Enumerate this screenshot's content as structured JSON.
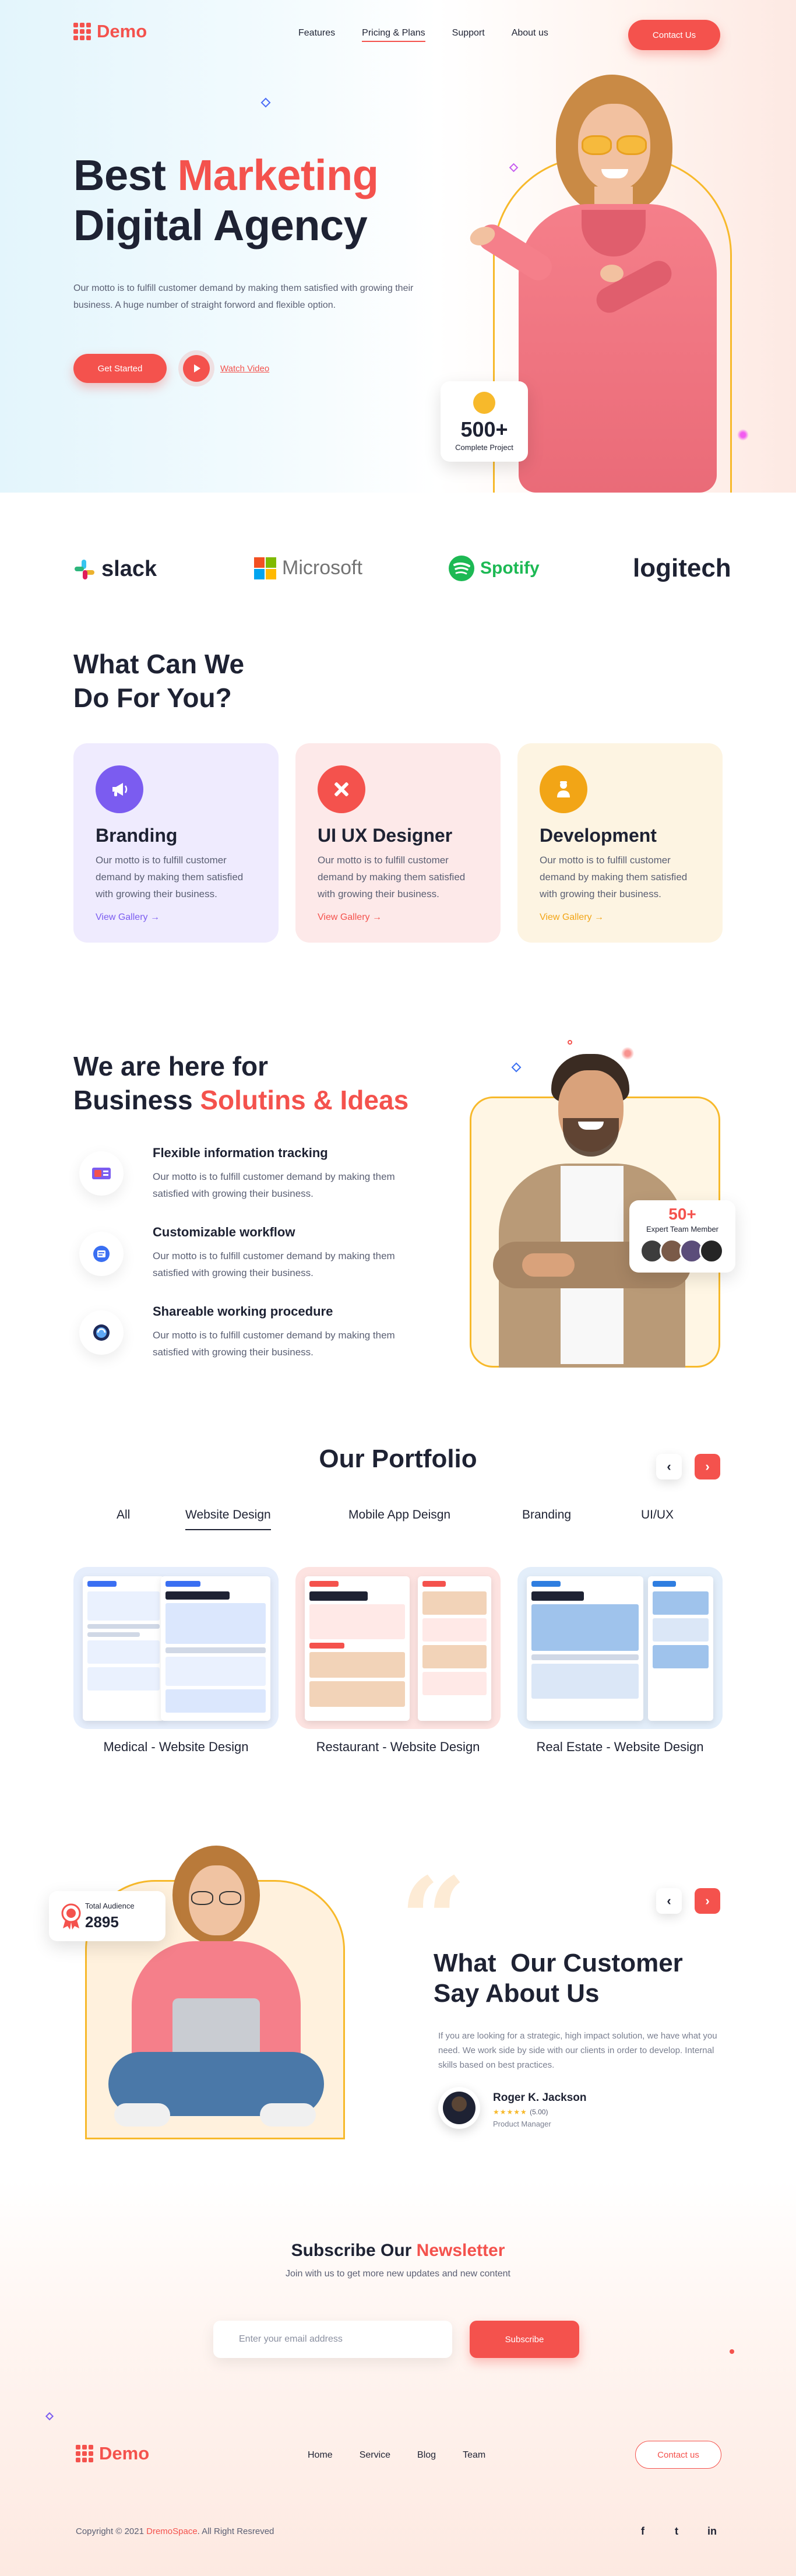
{
  "brand": {
    "name": "Demo",
    "accent": "#f4524d",
    "gold": "#f7b92b"
  },
  "nav": {
    "items": [
      "Features",
      "Pricing & Plans",
      "Support",
      "About us"
    ],
    "active": "Pricing & Plans",
    "contact_label": "Contact Us"
  },
  "hero": {
    "title_a": "Best ",
    "title_b": "Marketing",
    "title_c": "Digital Agency",
    "description": "Our motto is to fulfill customer demand by making them satisfied with growing their business. A huge number of straight forword and flexible option.",
    "cta_label": "Get Started",
    "video_label": "Watch Video",
    "stat_value": "500+",
    "stat_label": "Complete Project"
  },
  "brands": [
    "slack",
    "Microsoft",
    "Spotify",
    "logitech"
  ],
  "services": {
    "title_line1": "What Can We",
    "title_line2": "Do For You?",
    "link_label": "View Gallery →",
    "cards": [
      {
        "title": "Branding",
        "text": "Our motto is to fulfill customer demand by making them satisfied with growing their business.",
        "icon": "megaphone-icon",
        "bg": "#efebfe",
        "color": "#7b5cf0"
      },
      {
        "title": "UI UX Designer",
        "text": "Our motto is to fulfill customer demand by making them satisfied with growing their business.",
        "icon": "pencil-ruler-icon",
        "bg": "#fde9e9",
        "color": "#f4524d"
      },
      {
        "title": "Development",
        "text": "Our motto is to fulfill customer demand by making them satisfied with growing their business.",
        "icon": "developer-icon",
        "bg": "#fdf4e2",
        "color": "#f2a516"
      }
    ]
  },
  "features": {
    "title_line1": "We are here for",
    "title_line2a": "Business ",
    "title_line2b": "Solutins & Ideas",
    "items": [
      {
        "title": "Flexible information tracking",
        "text": "Our motto is to fulfill customer demand by making them satisfied with growing their business.",
        "icon": "tracking-icon"
      },
      {
        "title": "Customizable workflow",
        "text": "Our motto is to fulfill customer demand by making them satisfied with growing their business.",
        "icon": "workflow-icon"
      },
      {
        "title": "Shareable working procedure",
        "text": "Our motto is to fulfill customer demand by making them satisfied with growing their business.",
        "icon": "share-icon"
      }
    ],
    "team_value": "50+",
    "team_label": "Expert Team Member"
  },
  "portfolio": {
    "title": "Our Portfolio",
    "tabs": [
      "All",
      "Website Design",
      "Mobile App Deisgn",
      "Branding",
      "UI/UX"
    ],
    "active_tab": "Website Design",
    "items": [
      {
        "caption": "Medical - Website Design",
        "bg": "#e6eefc",
        "accent": "#3a6ff2"
      },
      {
        "caption": "Restaurant - Website Design",
        "bg": "#fde3e1",
        "accent": "#f4524d"
      },
      {
        "caption": "Real Estate - Website Design",
        "bg": "#e3eefa",
        "accent": "#2f7ee0"
      }
    ]
  },
  "testimonial": {
    "audience_label": "Total Audience",
    "audience_value": "2895",
    "title_line1": "What  Our Customer",
    "title_line2": "Say About Us",
    "text": "If you are looking for a strategic, high impact solution, we have what you need. We work side by side with our clients in order to develop. Internal skills based on best practices.",
    "name": "Roger K. Jackson",
    "rating": 5,
    "rating_label": "(5.00)",
    "role": "Product Manager"
  },
  "newsletter": {
    "title_a": "Subscribe Our ",
    "title_b": "Newsletter",
    "subtitle": "Join with us to get more new updates and new content",
    "placeholder": "Enter your email address",
    "button_label": "Subscribe"
  },
  "footer": {
    "links": [
      "Home",
      "Service",
      "Blog",
      "Team"
    ],
    "contact_label": "Contact us",
    "copyright_a": "Copyright © 2021 ",
    "copyright_b": "DremoSpace",
    "copyright_c": ". All Right Resreved",
    "social": [
      "f",
      "t",
      "in"
    ]
  }
}
